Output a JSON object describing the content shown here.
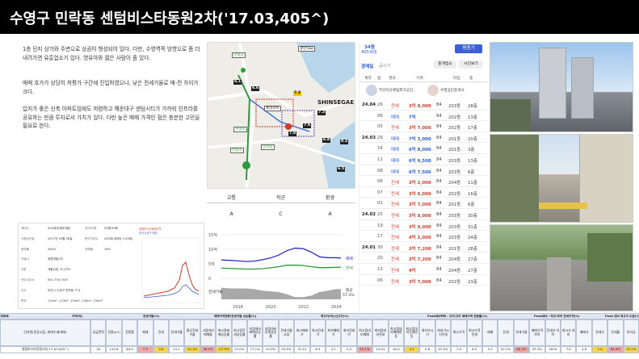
{
  "title": "수영구 민락동 센텀비스타동원2차('17.03,405^)",
  "description": {
    "p1": "1층 단지 상가와 주변으로 상권이 형성되어 있다. 다만, 수영역쪽 방향으로 좀 더 내려가면 유흥업소기 있다. 영유아와 젊은 사람이 좀 있다.",
    "p2": "매매 호가가 상당히 저평가 구간에 진입하였으나, 낮은 전세가율로 매-전 차이가 크다.",
    "p3": "입지가 좋은 신축 아파트임에도 저렴하고 해운대구 센텀시티가 가까워 인프라를 공유하는 만큼 투자로서 가치가 있다. 다만 높은 매매 가격인 점은 충분한 고민을 필요로 한다."
  },
  "map": {
    "labels": [
      "민락초",
      "광안대교",
      "롯데마트",
      "수영초",
      "민락중",
      "한양초",
      "SHINSEGAE"
    ],
    "badges": [
      "6.1",
      "7.2",
      "7.3",
      "7.6",
      "7.8",
      "6.5",
      "8.3",
      "6.6",
      "6.8"
    ],
    "notes": [
      "센텀비스타동원2차",
      "수영강변 주거지역"
    ]
  },
  "grades": {
    "headers": [
      "교통",
      "학군",
      "환경"
    ],
    "values": [
      "A",
      "C",
      "A"
    ]
  },
  "info": {
    "rows": [
      {
        "label": "세대수",
        "value": "405세대(총8개동)"
      },
      {
        "label": "사용승인일",
        "value": "2017년 03월 28일"
      },
      {
        "label": "용적률",
        "value": "260%"
      },
      {
        "label": "건설사",
        "value": "동원개발(주)"
      },
      {
        "label": "난방",
        "value": "개별난방, 도시가스"
      },
      {
        "label": "관리사무소",
        "value": "051-755-7537"
      },
      {
        "label": "주소",
        "value": "부산시 수영구 민락동 774"
      },
      {
        "label": "면적",
        "value": "112m², 113m², 115m², 130m², 133m²"
      }
    ],
    "extra": [
      {
        "label": "저/최고층",
        "value": "20층/33층"
      },
      {
        "label": "총주차대수",
        "value": "435대(세대당 1.09대)"
      },
      {
        "label": "건폐율",
        "value": "16%"
      }
    ]
  },
  "small_chart": {
    "legend": [
      "센텀비스타동원2차",
      "부산수영구 평균"
    ]
  },
  "transactions": {
    "header": {
      "count_label": "34평",
      "units": "405세대",
      "btn": "평종기",
      "tab_active": "경매일",
      "tab2": "공시가",
      "btn2": "중개업소",
      "btn3": "사진보기"
    },
    "columns": [
      "계약",
      "일",
      "경과",
      "가격",
      "",
      "타입",
      "층"
    ],
    "agent": "부산다산센텀파크공인..",
    "agent2": "수영공인중개사",
    "rows": [
      {
        "date": "24.04",
        "day": "26",
        "type": "전세",
        "price": "3억 8,000",
        "area": "84",
        "dong": "203동",
        "floor": "28층",
        "kind": "jeonse"
      },
      {
        "date": "",
        "day": "06",
        "type": "매매",
        "price": "7억",
        "area": "84",
        "dong": "202동",
        "floor": "13층",
        "kind": "sale"
      },
      {
        "date": "",
        "day": "05",
        "type": "전세",
        "price": "3억 7,000",
        "area": "84",
        "dong": "202동",
        "floor": "17층",
        "kind": "jeonse"
      },
      {
        "date": "24.03",
        "day": "29",
        "type": "매매",
        "price": "7억 3,000",
        "area": "84",
        "dong": "201동",
        "floor": "20층",
        "kind": "sale"
      },
      {
        "date": "",
        "day": "16",
        "type": "매매",
        "price": "6억 8,000",
        "area": "84",
        "dong": "201동",
        "floor": "3층",
        "kind": "sale"
      },
      {
        "date": "",
        "day": "11",
        "type": "매매",
        "price": "6억 9,500",
        "area": "84",
        "dong": "203동",
        "floor": "13층",
        "kind": "sale"
      },
      {
        "date": "",
        "day": "08",
        "type": "매매",
        "price": "6억 7,500",
        "area": "84",
        "dong": "203동",
        "floor": "6층",
        "kind": "sale"
      },
      {
        "date": "",
        "day": "06",
        "type": "전세",
        "price": "3억 2,000",
        "area": "84",
        "dong": "204동",
        "floor": "11층",
        "kind": "jeonse"
      },
      {
        "date": "",
        "day": "07",
        "type": "전세",
        "price": "3억 6,000",
        "area": "84",
        "dong": "202동",
        "floor": "16층",
        "kind": "jeonse"
      },
      {
        "date": "",
        "day": "01",
        "type": "전세",
        "price": "3억 7,000",
        "area": "84",
        "dong": "201동",
        "floor": "6층",
        "kind": "jeonse"
      },
      {
        "date": "24.02",
        "day": "25",
        "type": "전세",
        "price": "3억 8,000",
        "area": "84",
        "dong": "203동",
        "floor": "30층",
        "kind": "jeonse"
      },
      {
        "date": "",
        "day": "19",
        "type": "전세",
        "price": "3억 9,000",
        "area": "84",
        "dong": "203동",
        "floor": "31층",
        "kind": "jeonse"
      },
      {
        "date": "",
        "day": "17",
        "type": "전세",
        "price": "4억 1,000",
        "area": "84",
        "dong": "203동",
        "floor": "24층",
        "kind": "jeonse"
      },
      {
        "date": "24.01",
        "day": "30",
        "type": "전세",
        "price": "3억 7,200",
        "area": "84",
        "dong": "201동",
        "floor": "28층",
        "kind": "jeonse"
      },
      {
        "date": "",
        "day": "20",
        "type": "전세",
        "price": "3억 7,200",
        "area": "84",
        "dong": "204동",
        "floor": "27층",
        "kind": "jeonse"
      },
      {
        "date": "",
        "day": "13",
        "type": "전세",
        "price": "4억",
        "area": "84",
        "dong": "204동",
        "floor": "27층",
        "kind": "jeonse"
      },
      {
        "date": "",
        "day": "06",
        "type": "전세",
        "price": "3억 7,000",
        "area": "84",
        "dong": "202동",
        "floor": "23층",
        "kind": "jeonse"
      }
    ]
  },
  "main_chart": {
    "chart_data": {
      "type": "line",
      "x": [
        2017,
        2017.5,
        2018,
        2018.5,
        2019,
        2019.5,
        2020,
        2020.5,
        2021,
        2021.5,
        2022,
        2022.5,
        2023,
        2023.5,
        2024,
        2024.3
      ],
      "series": [
        {
          "name": "매매",
          "values": [
            6.3,
            6.2,
            6.0,
            5.8,
            5.9,
            6.4,
            7.0,
            8.0,
            9.5,
            10.4,
            10.2,
            9.0,
            7.4,
            7.1,
            7.1,
            7.0
          ]
        },
        {
          "name": "전세",
          "values": [
            3.5,
            3.4,
            3.3,
            3.2,
            3.2,
            3.3,
            3.6,
            4.0,
            4.5,
            4.5,
            4.4,
            4.0,
            3.7,
            3.7,
            3.8,
            3.8
          ]
        }
      ],
      "xlabel": "",
      "ylabel": "",
      "ylim": [
        0,
        15
      ],
      "ytick_labels": [
        "15억",
        "10억",
        "5억",
        "0"
      ],
      "xtick_labels": [
        "2018",
        "2020",
        "2022",
        "2024"
      ],
      "sub_label": "전세가율",
      "sub_value_label": "평균",
      "sub_value": "57.3%",
      "ratio": [
        56,
        55,
        55,
        55,
        54,
        52,
        51,
        50,
        47,
        43,
        43,
        45,
        50,
        52,
        54,
        54
      ]
    }
  },
  "bottom_table": {
    "groups": [
      "아파트",
      "",
      "가격(억)",
      "",
      "전세가율(%)",
      "",
      "매매가격변화/전세가율 상승률(%)",
      "",
      "",
      "최고가(억)/신고가(%)",
      "",
      "",
      "Peak대비하락 : 고가/고가 매매가격 변동률(%)",
      "",
      "",
      "Peak대비 : 최고-최저 전세가격(%)",
      "",
      "Peak 대비 최고가 수준(%)"
    ],
    "head": [
      "단지명(준공시점, 세대수/총세대)",
      "공급면적",
      "전용(m²)",
      "전용평",
      "매매",
      "전세",
      "전세가율",
      "평균전세가율",
      "고점대비매매율",
      "최고점매매상승률",
      "최고점전세상승률",
      "저점대비매매상승률",
      "저점대비전세상승률",
      "전세가율고점",
      "최고매매가",
      "최고전세가",
      "최저매매가",
      "최저전세가",
      "최고점대비매매",
      "최저점대비전세",
      "최고점대비매매변동",
      "최고점대비전세변동",
      "최저가시기",
      "최저가시기전세",
      "최고가격",
      "최고가격전세",
      "매매",
      "전세",
      "전세가율",
      "매매가격 하락",
      "전세가 하락",
      "최고가 대비",
      "매매가",
      "전세가",
      "전세율",
      "투자금"
    ],
    "values": [
      "센텀비스타동원2차('17.03,405^)",
      "34",
      "112.6",
      "84.9",
      "7.3",
      "3.8",
      "51.1",
      "52.1%",
      "38.5%",
      "-27.5%",
      "37.0%",
      "77.1%",
      "15.9%",
      "33.9%",
      "22.12",
      "6.3",
      "3.1",
      "5.2",
      "43.1%",
      "23.01",
      "10.0",
      "4.1",
      "5.8",
      "41.9%",
      "7.0",
      "6.2",
      "3.1",
      "52.1%",
      "60.3%",
      "33.3%",
      "2024",
      "7.0",
      "4.0",
      "3.0",
      "64.8%",
      "33.1%"
    ]
  }
}
